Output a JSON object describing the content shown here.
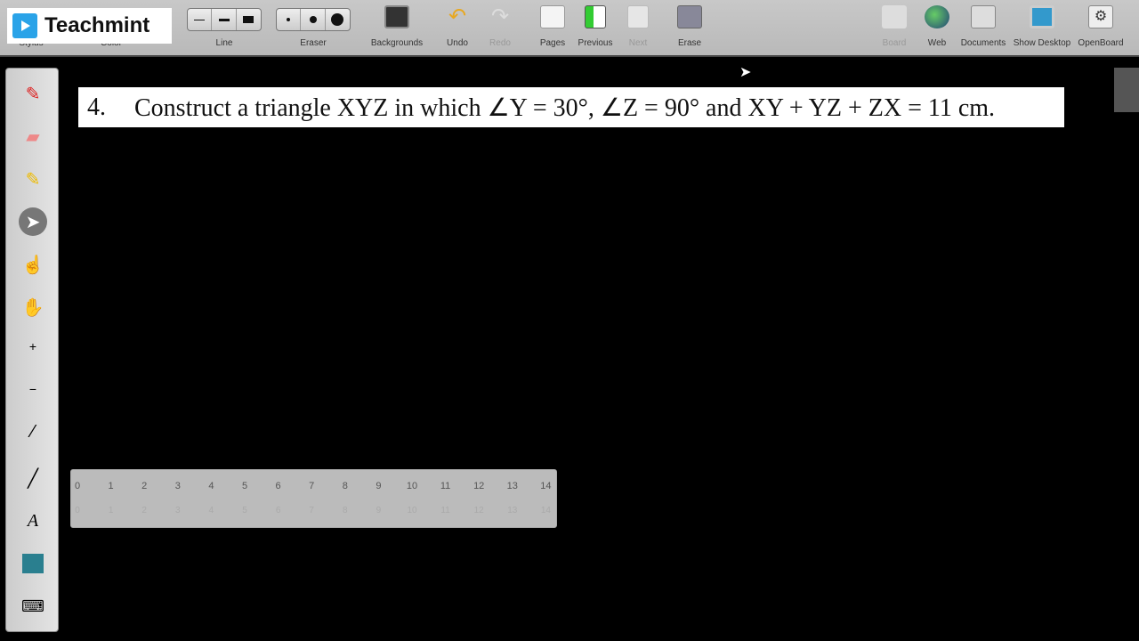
{
  "watermark": {
    "name": "Teachmint"
  },
  "toolbar": {
    "stylus_label": "Stylus",
    "color_label": "Color",
    "line_label": "Line",
    "eraser_label": "Eraser",
    "backgrounds_label": "Backgrounds",
    "undo_label": "Undo",
    "redo_label": "Redo",
    "pages_label": "Pages",
    "previous_label": "Previous",
    "next_label": "Next",
    "erase_label": "Erase",
    "board_label": "Board",
    "web_label": "Web",
    "documents_label": "Documents",
    "show_desktop_label": "Show Desktop",
    "openboard_label": "OpenBoard"
  },
  "question": {
    "number": "4.",
    "text": "Construct a triangle XYZ in which ∠Y = 30°, ∠Z = 90° and XY + YZ + ZX = 11 cm."
  },
  "ruler": {
    "ticks": [
      "0",
      "1",
      "2",
      "3",
      "4",
      "5",
      "6",
      "7",
      "8",
      "9",
      "10",
      "11",
      "12",
      "13",
      "14"
    ]
  },
  "colors": {
    "toolbar": "#c0c0c0",
    "board": "#000000",
    "accent": "#2aa3e8"
  }
}
